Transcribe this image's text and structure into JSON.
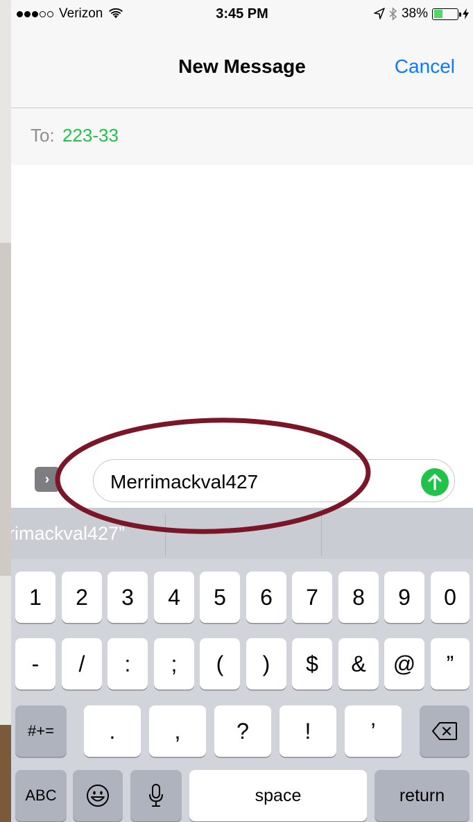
{
  "status_bar": {
    "carrier": "Verizon",
    "time": "3:45 PM",
    "battery": "38%",
    "battery_level": 0.38,
    "signal_bars": 3,
    "signal_total": 5
  },
  "nav": {
    "title": "New Message",
    "cancel_label": "Cancel"
  },
  "recipient": {
    "label": "To:",
    "value": "223-33"
  },
  "composer": {
    "text": "Merrimackval427",
    "apps_glyph": "›"
  },
  "predictive": {
    "suggestions": [
      "rimackval427”",
      "",
      ""
    ]
  },
  "keyboard": {
    "row1": [
      "1",
      "2",
      "3",
      "4",
      "5",
      "6",
      "7",
      "8",
      "9",
      "0"
    ],
    "row2": [
      "-",
      "/",
      ":",
      ";",
      "(",
      ")",
      "$",
      "&",
      "@",
      "”"
    ],
    "row3": {
      "shift": "#+=",
      "keys": [
        ".",
        ",",
        "?",
        "!",
        "’"
      ]
    },
    "row4": {
      "abc": "ABC",
      "space": "space",
      "return": "return"
    }
  },
  "colors": {
    "accent_blue": "#0a7aff",
    "green": "#21c24a",
    "annotation": "#7b1528"
  },
  "icons": [
    "wifi-icon",
    "location-icon",
    "bluetooth-icon",
    "battery-icon",
    "charging-icon",
    "send-arrow-icon",
    "emoji-icon",
    "microphone-icon",
    "delete-icon"
  ]
}
